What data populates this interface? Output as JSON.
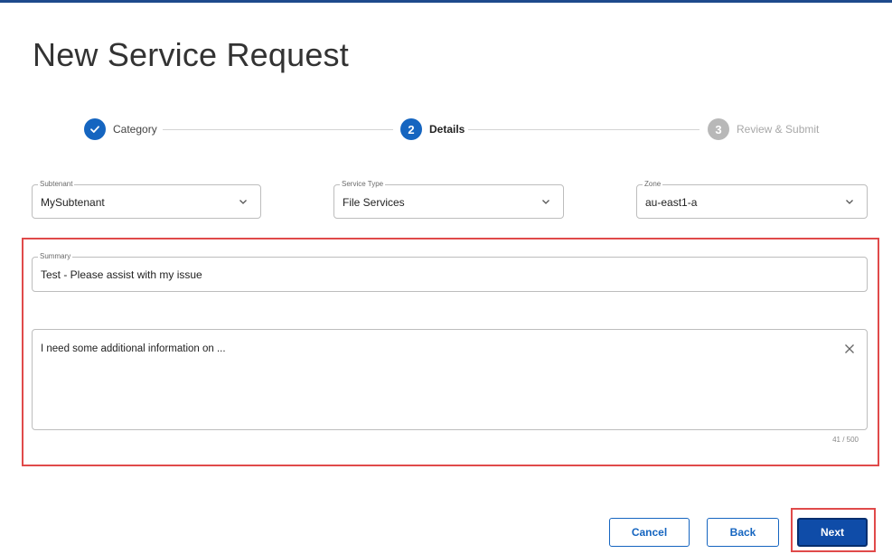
{
  "page": {
    "title": "New Service Request"
  },
  "stepper": {
    "steps": [
      {
        "number": "1",
        "label": "Category",
        "state": "done"
      },
      {
        "number": "2",
        "label": "Details",
        "state": "active"
      },
      {
        "number": "3",
        "label": "Review & Submit",
        "state": "pending"
      }
    ]
  },
  "fields": {
    "subtenant": {
      "label": "Subtenant",
      "value": "MySubtenant"
    },
    "service_type": {
      "label": "Service Type",
      "value": "File Services"
    },
    "zone": {
      "label": "Zone",
      "value": "au-east1-a"
    },
    "summary": {
      "label": "Summary",
      "value": "Test - Please assist with my issue"
    },
    "description": {
      "value": "I need some additional information on ...",
      "char_count": "41 / 500"
    }
  },
  "buttons": {
    "cancel": "Cancel",
    "back": "Back",
    "next": "Next"
  },
  "colors": {
    "accent": "#1565c0",
    "highlight": "#e04a4a",
    "pending": "#b8b8b8"
  },
  "icons": [
    "check-icon",
    "chevron-down-icon",
    "close-icon"
  ]
}
